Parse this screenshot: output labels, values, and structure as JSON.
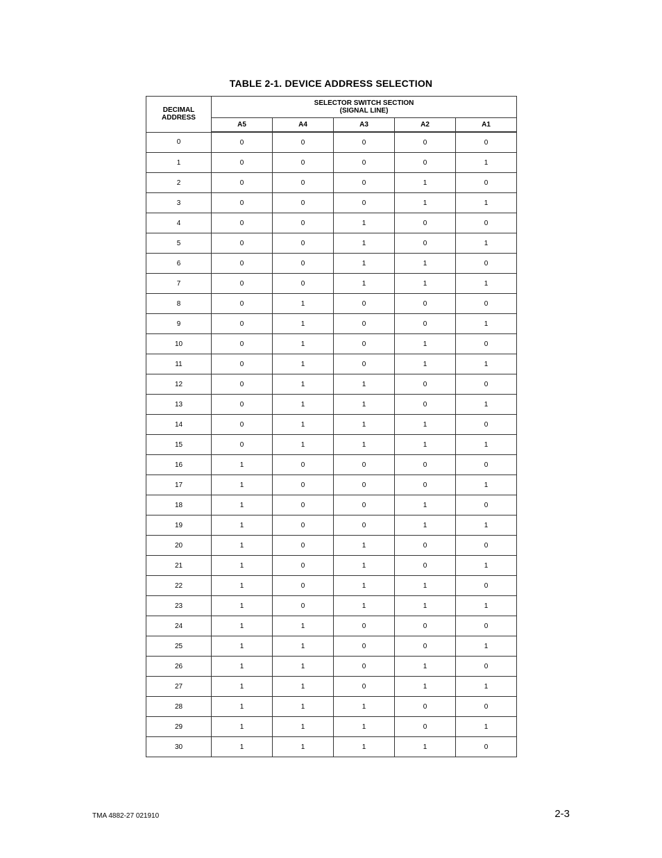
{
  "table": {
    "caption": "TABLE 2-1.  DEVICE ADDRESS SELECTION",
    "header": {
      "decimal_line1": "DECIMAL",
      "decimal_line2": "ADDRESS",
      "group_line1": "SELECTOR SWITCH SECTION",
      "group_line2": "(SIGNAL LINE)",
      "signals": [
        "A5",
        "A4",
        "A3",
        "A2",
        "A1"
      ]
    },
    "rows": [
      {
        "addr": "0",
        "v": [
          "0",
          "0",
          "0",
          "0",
          "0"
        ]
      },
      {
        "addr": "1",
        "v": [
          "0",
          "0",
          "0",
          "0",
          "1"
        ]
      },
      {
        "addr": "2",
        "v": [
          "0",
          "0",
          "0",
          "1",
          "0"
        ]
      },
      {
        "addr": "3",
        "v": [
          "0",
          "0",
          "0",
          "1",
          "1"
        ]
      },
      {
        "addr": "4",
        "v": [
          "0",
          "0",
          "1",
          "0",
          "0"
        ]
      },
      {
        "addr": "5",
        "v": [
          "0",
          "0",
          "1",
          "0",
          "1"
        ]
      },
      {
        "addr": "6",
        "v": [
          "0",
          "0",
          "1",
          "1",
          "0"
        ]
      },
      {
        "addr": "7",
        "v": [
          "0",
          "0",
          "1",
          "1",
          "1"
        ]
      },
      {
        "addr": "8",
        "v": [
          "0",
          "1",
          "0",
          "0",
          "0"
        ]
      },
      {
        "addr": "9",
        "v": [
          "0",
          "1",
          "0",
          "0",
          "1"
        ]
      },
      {
        "addr": "10",
        "v": [
          "0",
          "1",
          "0",
          "1",
          "0"
        ]
      },
      {
        "addr": "11",
        "v": [
          "0",
          "1",
          "0",
          "1",
          "1"
        ]
      },
      {
        "addr": "12",
        "v": [
          "0",
          "1",
          "1",
          "0",
          "0"
        ]
      },
      {
        "addr": "13",
        "v": [
          "0",
          "1",
          "1",
          "0",
          "1"
        ]
      },
      {
        "addr": "14",
        "v": [
          "0",
          "1",
          "1",
          "1",
          "0"
        ]
      },
      {
        "addr": "15",
        "v": [
          "0",
          "1",
          "1",
          "1",
          "1"
        ]
      },
      {
        "addr": "16",
        "v": [
          "1",
          "0",
          "0",
          "0",
          "0"
        ]
      },
      {
        "addr": "17",
        "v": [
          "1",
          "0",
          "0",
          "0",
          "1"
        ]
      },
      {
        "addr": "18",
        "v": [
          "1",
          "0",
          "0",
          "1",
          "0"
        ]
      },
      {
        "addr": "19",
        "v": [
          "1",
          "0",
          "0",
          "1",
          "1"
        ]
      },
      {
        "addr": "20",
        "v": [
          "1",
          "0",
          "1",
          "0",
          "0"
        ]
      },
      {
        "addr": "21",
        "v": [
          "1",
          "0",
          "1",
          "0",
          "1"
        ]
      },
      {
        "addr": "22",
        "v": [
          "1",
          "0",
          "1",
          "1",
          "0"
        ]
      },
      {
        "addr": "23",
        "v": [
          "1",
          "0",
          "1",
          "1",
          "1"
        ]
      },
      {
        "addr": "24",
        "v": [
          "1",
          "1",
          "0",
          "0",
          "0"
        ]
      },
      {
        "addr": "25",
        "v": [
          "1",
          "1",
          "0",
          "0",
          "1"
        ]
      },
      {
        "addr": "26",
        "v": [
          "1",
          "1",
          "0",
          "1",
          "0"
        ]
      },
      {
        "addr": "27",
        "v": [
          "1",
          "1",
          "0",
          "1",
          "1"
        ]
      },
      {
        "addr": "28",
        "v": [
          "1",
          "1",
          "1",
          "0",
          "0"
        ]
      },
      {
        "addr": "29",
        "v": [
          "1",
          "1",
          "1",
          "0",
          "1"
        ]
      },
      {
        "addr": "30",
        "v": [
          "1",
          "1",
          "1",
          "1",
          "0"
        ]
      }
    ]
  },
  "footer": {
    "left": "TMA 4882-27 021910",
    "right": "2-3"
  }
}
